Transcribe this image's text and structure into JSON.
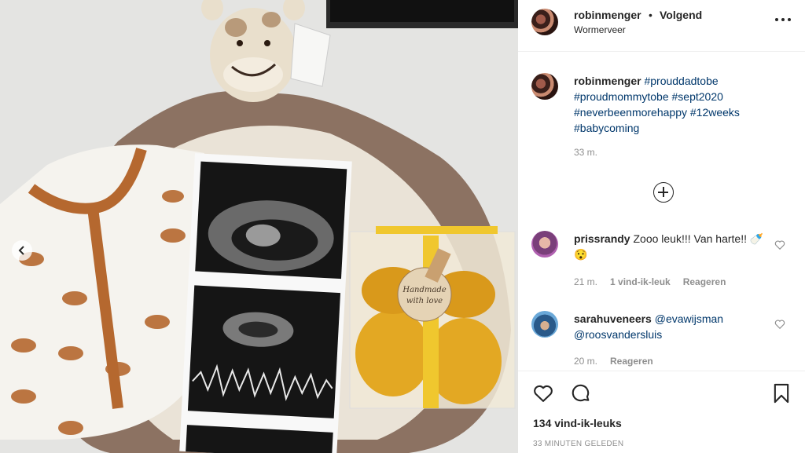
{
  "post": {
    "photo_label_line1": "Handmade",
    "photo_label_line2": "with love"
  },
  "header": {
    "username": "robinmenger",
    "separator": "•",
    "follow_label": "Volgend",
    "location": "Wormerveer",
    "more_icon": "more-options-icon"
  },
  "caption": {
    "username": "robinmenger",
    "hashtags": [
      "#prouddadtobe",
      "#proudmommytobe",
      "#sept2020",
      "#neverbeenmorehappy",
      "#12weeks",
      "#babycoming"
    ],
    "time": "33 m."
  },
  "comments": [
    {
      "username": "prissrandy",
      "text": "Zooo leuk!!! Van harte!! 🍼😯",
      "time": "21 m.",
      "likes_label": "1 vind-ik-leuk",
      "reply_label": "Reageren"
    },
    {
      "username": "sarahuveneers",
      "mentions": [
        "@evawijsman",
        "@roosvandersluis"
      ],
      "time": "20 m.",
      "reply_label": "Reageren"
    }
  ],
  "footer": {
    "likes_count": "134 vind-ik-leuks",
    "posted_ago": "33 MINUTEN GELEDEN"
  },
  "colors": {
    "text": "#262626",
    "secondary": "#8e8e8e",
    "link": "#00376b",
    "divider": "#efefef"
  }
}
